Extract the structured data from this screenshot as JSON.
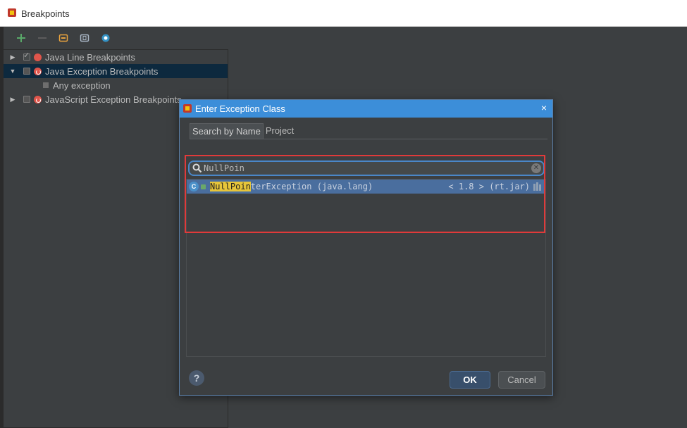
{
  "window": {
    "title": "Breakpoints"
  },
  "toolbar": {
    "icons": [
      "add-icon",
      "remove-icon",
      "group-by-package-icon",
      "group-by-file-icon",
      "view-breakpoints-icon"
    ]
  },
  "tree": {
    "items": [
      {
        "label": "Java Line Breakpoints",
        "expanded": false,
        "checked": true,
        "icon": "line-breakpoint-icon"
      },
      {
        "label": "Java Exception Breakpoints",
        "expanded": true,
        "checked": false,
        "icon": "exception-breakpoint-icon",
        "selected": true
      },
      {
        "label": "Any exception",
        "indent": true
      },
      {
        "label": "JavaScript Exception Breakpoints",
        "expanded": false,
        "checked": false,
        "icon": "exception-breakpoint-icon"
      }
    ]
  },
  "dialog": {
    "title": "Enter Exception Class",
    "close": "×",
    "tabs": [
      "Search by Name",
      "Project"
    ],
    "search": {
      "value": "NullPoin"
    },
    "result": {
      "match": "NullPoin",
      "rest": "terException (java.lang)",
      "location": "< 1.8 > (rt.jar)"
    },
    "help": "?",
    "ok_label": "OK",
    "cancel_label": "Cancel"
  },
  "colors": {
    "title_bar_accent": "#3c8ed9",
    "highlight": "#e6c53a",
    "selection": "#4a6e9e",
    "annotation_box": "#e03a3a"
  }
}
